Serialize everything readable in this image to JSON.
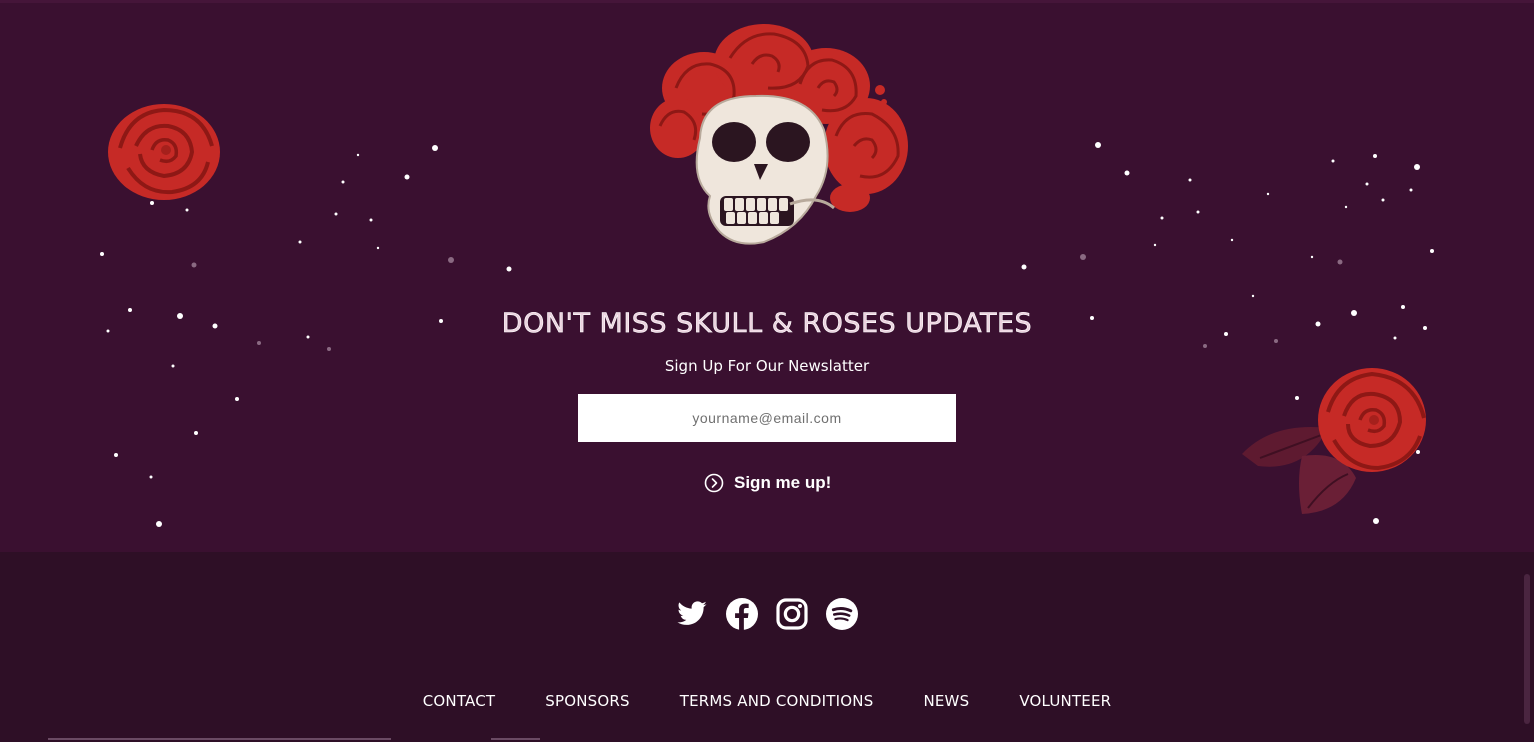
{
  "newsletter": {
    "headline": "DON'T MISS SKULL & ROSES UPDATES",
    "subheading": "Sign Up For Our Newslatter",
    "email_placeholder": "yourname@email.com",
    "signup_label": "Sign me up!"
  },
  "social": [
    {
      "name": "twitter",
      "icon": "twitter-icon"
    },
    {
      "name": "facebook",
      "icon": "facebook-icon"
    },
    {
      "name": "instagram",
      "icon": "instagram-icon"
    },
    {
      "name": "spotify",
      "icon": "spotify-icon"
    }
  ],
  "footer_nav": [
    {
      "label": "CONTACT"
    },
    {
      "label": "SPONSORS"
    },
    {
      "label": "TERMS AND CONDITIONS"
    },
    {
      "label": "NEWS"
    },
    {
      "label": "VOLUNTEER"
    }
  ],
  "colors": {
    "newsletter_bg": "#3a1030",
    "footer_bg": "#2e0f26",
    "rose_red": "#c62a26",
    "skull": "#efe6dc",
    "text": "#ffffff"
  }
}
